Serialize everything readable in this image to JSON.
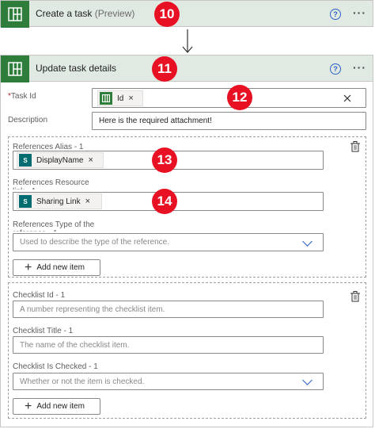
{
  "card1": {
    "title": "Create a task",
    "subtitle": "(Preview)",
    "badge": "10",
    "help": "?",
    "more": "···"
  },
  "card2": {
    "title": "Update task details",
    "badge": "11",
    "help": "?",
    "more": "···"
  },
  "task_id": {
    "required": "*",
    "label": "Task Id",
    "token": "Id",
    "badge": "12"
  },
  "description": {
    "label": "Description",
    "value": "Here is the required attachment!"
  },
  "references": {
    "alias_label": "References Alias - 1",
    "alias_token": "DisplayName",
    "alias_badge": "13",
    "resource_label": "References Resource link - 1",
    "resource_token": "Sharing Link",
    "resource_badge": "14",
    "type_label": "References Type of the reference - 1",
    "type_placeholder": "Used to describe the type of the reference.",
    "add_button": "Add new item"
  },
  "checklist": {
    "id_label": "Checklist Id - 1",
    "id_placeholder": "A number representing the checklist item.",
    "title_label": "Checklist Title - 1",
    "title_placeholder": "The name of the checklist item.",
    "checked_label": "Checklist Is Checked - 1",
    "checked_placeholder": "Whether or not the item is checked.",
    "add_button": "Add new item"
  },
  "colors": {
    "planner_green": "#2f7d3a",
    "badge_red": "#e81123",
    "link_blue": "#2a62c9",
    "header_bg": "#e1e9e3"
  },
  "icons": [
    "planner-icon",
    "help-icon",
    "more-icon",
    "arrow-down-icon",
    "close-icon",
    "sharepoint-icon",
    "chevron-down-icon",
    "trash-icon",
    "plus-icon"
  ]
}
